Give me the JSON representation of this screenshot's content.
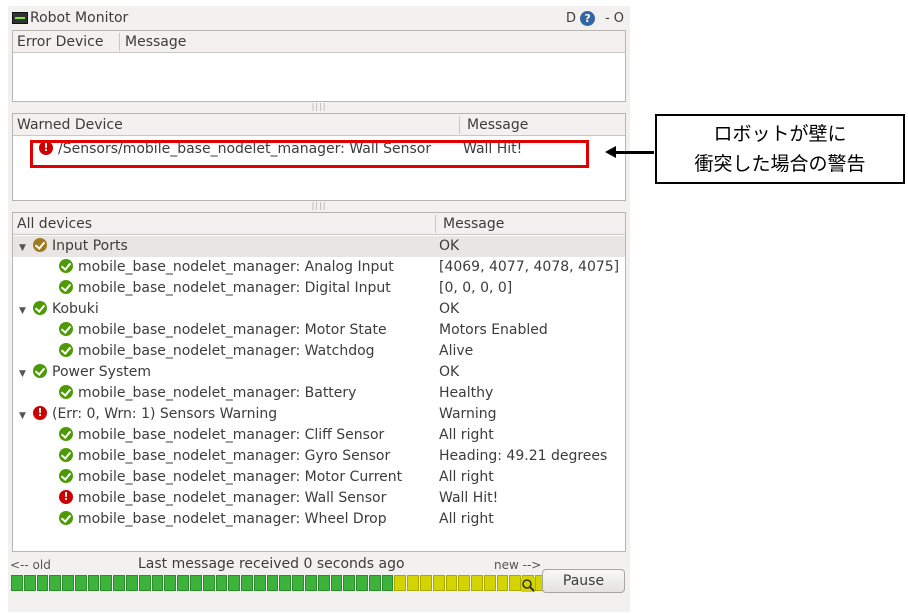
{
  "window": {
    "title": "Robot Monitor",
    "btn_d": "D",
    "btn_help": "?",
    "btn_min": "-",
    "btn_close": "O"
  },
  "error_panel": {
    "col_device": "Error Device",
    "col_message": "Message"
  },
  "warn_panel": {
    "col_device": "Warned Device",
    "col_message": "Message",
    "rows": [
      {
        "device": "/Sensors/mobile_base_nodelet_manager: Wall Sensor",
        "message": "Wall Hit!",
        "status": "error"
      }
    ]
  },
  "all_panel": {
    "col_device": "All devices",
    "col_message": "Message",
    "rows": [
      {
        "indent": 0,
        "expander": "▼",
        "status": "ok-group",
        "name": "Input Ports",
        "message": "OK"
      },
      {
        "indent": 1,
        "status": "ok",
        "name": "mobile_base_nodelet_manager: Analog Input",
        "message": "[4069, 4077, 4078, 4075]"
      },
      {
        "indent": 1,
        "status": "ok",
        "name": "mobile_base_nodelet_manager: Digital Input",
        "message": "[0, 0, 0, 0]"
      },
      {
        "indent": 0,
        "expander": "▼",
        "status": "ok",
        "name": "Kobuki",
        "message": "OK"
      },
      {
        "indent": 1,
        "status": "ok",
        "name": "mobile_base_nodelet_manager: Motor State",
        "message": "Motors Enabled"
      },
      {
        "indent": 1,
        "status": "ok",
        "name": "mobile_base_nodelet_manager: Watchdog",
        "message": "Alive"
      },
      {
        "indent": 0,
        "expander": "▼",
        "status": "ok",
        "name": "Power System",
        "message": "OK"
      },
      {
        "indent": 1,
        "status": "ok",
        "name": "mobile_base_nodelet_manager: Battery",
        "message": "Healthy"
      },
      {
        "indent": 0,
        "expander": "▼",
        "status": "error",
        "name": "(Err: 0, Wrn: 1) Sensors Warning",
        "message": "Warning"
      },
      {
        "indent": 1,
        "status": "ok",
        "name": "mobile_base_nodelet_manager: Cliff Sensor",
        "message": "All right"
      },
      {
        "indent": 1,
        "status": "ok",
        "name": "mobile_base_nodelet_manager: Gyro Sensor",
        "message": "Heading: 49.21 degrees"
      },
      {
        "indent": 1,
        "status": "ok",
        "name": "mobile_base_nodelet_manager: Motor Current",
        "message": "All right"
      },
      {
        "indent": 1,
        "status": "error",
        "name": "mobile_base_nodelet_manager: Wall Sensor",
        "message": "Wall Hit!"
      },
      {
        "indent": 1,
        "status": "ok",
        "name": "mobile_base_nodelet_manager: Wheel Drop",
        "message": "All right"
      }
    ]
  },
  "status": {
    "old": "<-- old",
    "last_message": "Last message received 0 seconds ago",
    "new": "new -->"
  },
  "timeline": {
    "segments": [
      "g",
      "g",
      "g",
      "g",
      "g",
      "g",
      "g",
      "g",
      "g",
      "g",
      "g",
      "g",
      "g",
      "g",
      "g",
      "g",
      "g",
      "g",
      "g",
      "g",
      "g",
      "g",
      "g",
      "g",
      "g",
      "g",
      "g",
      "g",
      "g",
      "g",
      "y",
      "y",
      "y",
      "y",
      "y",
      "y",
      "y",
      "y",
      "y",
      "y",
      "y",
      "y"
    ]
  },
  "pause_label": "Pause",
  "callout": {
    "line1": "ロボットが壁に",
    "line2": "衝突した場合の警告"
  },
  "colors": {
    "ok": "#4e9a06",
    "error": "#cc0000",
    "highlight": "#e00000",
    "timeline_ok": "#3cb43c",
    "timeline_warn": "#d4d400"
  }
}
